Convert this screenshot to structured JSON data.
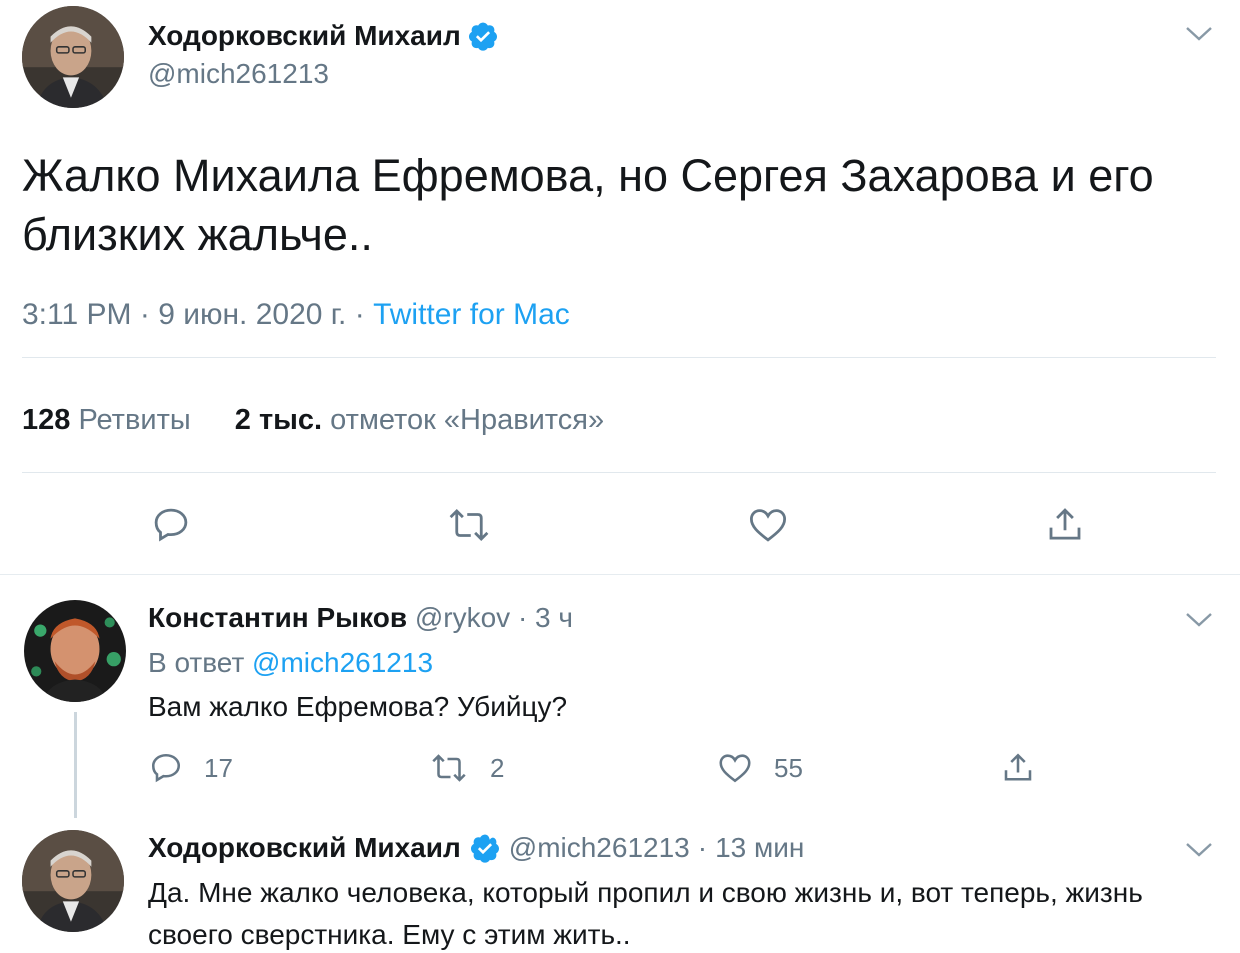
{
  "main_tweet": {
    "author_name": "Ходорковский Михаил",
    "author_handle": "@mich261213",
    "text": "Жалко Михаила Ефремова, но Сергея Захарова и его близких жальче..",
    "time": "3:11 PM",
    "date": "9 июн. 2020 г.",
    "source": "Twitter for Mac",
    "meta_separator": "·",
    "retweets_count": "128",
    "retweets_label": "Ретвиты",
    "likes_count": "2 тыс.",
    "likes_label": "отметок «Нравится»"
  },
  "replies": [
    {
      "author_name": "Константин Рыков",
      "author_handle": "@rykov",
      "time": "3 ч",
      "reply_to_prefix": "В ответ",
      "reply_to_handle": "@mich261213",
      "text": "Вам жалко Ефремова? Убийцу?",
      "reply_count": "17",
      "retweet_count": "2",
      "like_count": "55"
    },
    {
      "author_name": "Ходорковский Михаил",
      "author_handle": "@mich261213",
      "time": "13 мин",
      "text": "Да. Мне жалко человека, который пропил и свою жизнь и, вот теперь, жизнь своего сверстника. Ему с этим жить.."
    }
  ],
  "separator": "·",
  "colors": {
    "accent": "#1da1f2",
    "muted": "#657786",
    "text": "#14171a",
    "divider": "#e1e8ed"
  },
  "icons": [
    "verified-badge-icon",
    "chevron-down-icon",
    "reply-icon",
    "retweet-icon",
    "like-icon",
    "share-icon"
  ]
}
